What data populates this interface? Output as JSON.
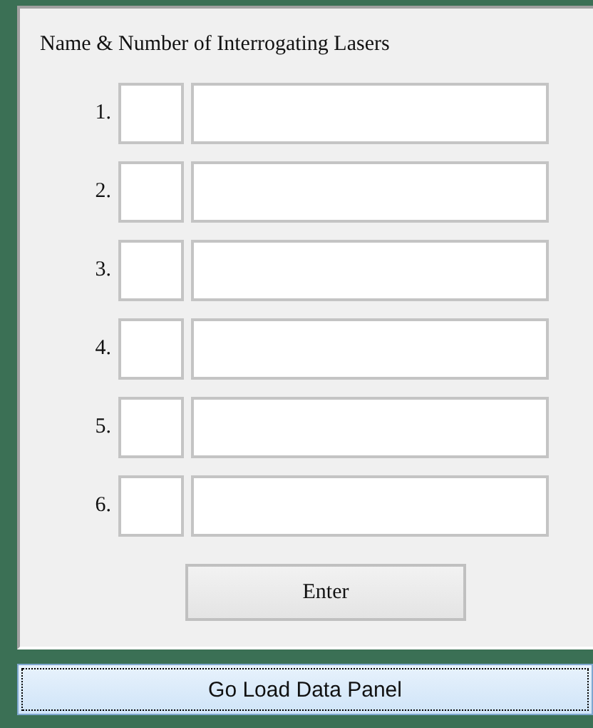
{
  "panel": {
    "title": "Name & Number of Interrogating Lasers",
    "rows": [
      {
        "number": "1."
      },
      {
        "number": "2."
      },
      {
        "number": "3."
      },
      {
        "number": "4."
      },
      {
        "number": "5."
      },
      {
        "number": "6."
      }
    ],
    "enter_button": "Enter"
  },
  "load_button": {
    "label": "Go Load Data Panel",
    "focused": true
  }
}
